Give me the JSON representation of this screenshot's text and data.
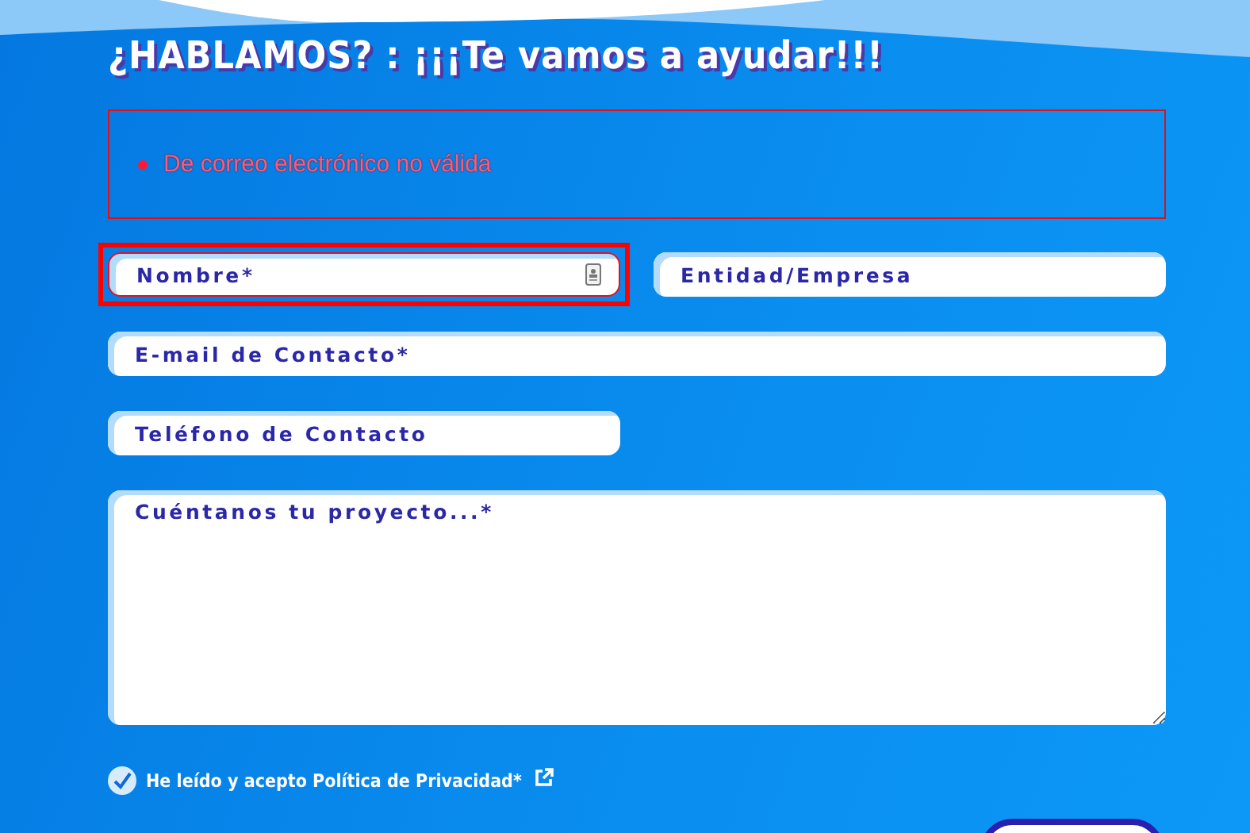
{
  "title": "¿HABLAMOS? : ¡¡¡Te vamos a ayudar!!!",
  "errors": [
    "De correo electrónico no válida"
  ],
  "fields": [
    {
      "kind": "short",
      "placeholder": "Nombre*",
      "invalid": true
    },
    {
      "kind": "short",
      "placeholder": "Entidad/Empresa",
      "invalid": false
    },
    {
      "kind": "long",
      "placeholder": "E-mail de Contacto*",
      "invalid": false
    },
    {
      "kind": "short",
      "placeholder": "Teléfono de Contacto",
      "invalid": false
    },
    {
      "kind": "multiline",
      "placeholder": "Cuéntanos tu proyecto...*",
      "invalid": false
    }
  ],
  "consent": {
    "label": "He leído y acepto Política de Privacidad*",
    "checked": true
  }
}
